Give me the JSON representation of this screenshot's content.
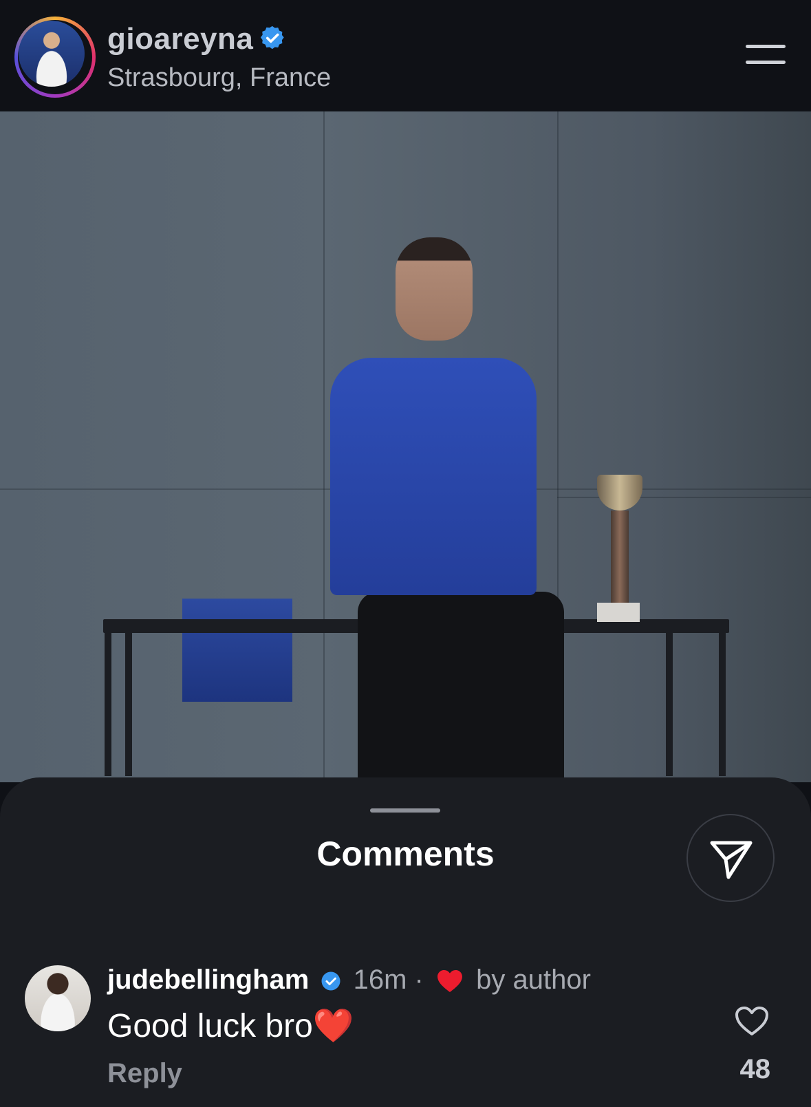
{
  "header": {
    "username": "gioareyna",
    "location": "Strasbourg, France",
    "verified_icon": "verified-badge-icon",
    "menu_icon": "menu-icon"
  },
  "post": {
    "image_kind": "photo"
  },
  "comments_sheet": {
    "title": "Comments",
    "share_icon": "send-icon"
  },
  "comment": {
    "username": "judebellingham",
    "time": "16m",
    "separator": "·",
    "liked_label": "by author",
    "text": "Good luck bro",
    "text_emoji": "❤️",
    "reply_label": "Reply",
    "like_count": "48",
    "colors": {
      "verified": "#3897f0",
      "heart": "#ed1c2e"
    }
  }
}
